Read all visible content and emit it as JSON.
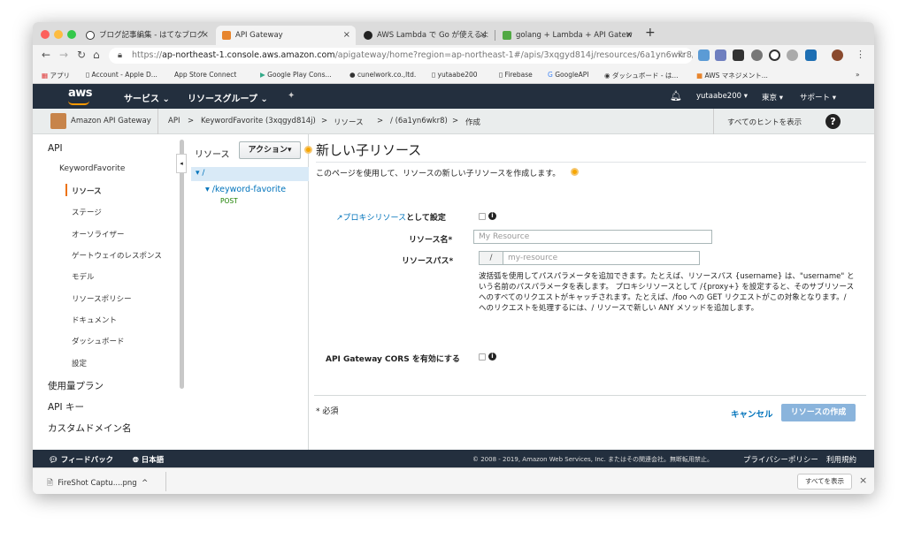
{
  "browser": {
    "tabs": [
      {
        "label": "ブログ記事編集 - はてなブログ",
        "active": false
      },
      {
        "label": "API Gateway",
        "active": true
      },
      {
        "label": "AWS Lambda で Go が使えるよ",
        "active": false
      },
      {
        "label": "golang + Lambda + API Gatew",
        "active": false
      }
    ],
    "url_secure": "https://",
    "url_host": "ap-northeast-1.console.aws.amazon.com",
    "url_path": "/apigateway/home?region=ap-northeast-1#/apis/3xqgyd814j/resources/6a1yn6wkr8/cr...",
    "bookmarks": [
      "アプリ",
      "Account - Apple D...",
      "App Store Connect",
      "Google Play Cons...",
      "cunelwork.co.,ltd.",
      "yutaabe200",
      "Firebase",
      "GoogleAPI",
      "ダッシュボード - は...",
      "AWS マネジメント..."
    ],
    "more": "»"
  },
  "aws_nav": {
    "logo": "aws",
    "services": "サービス ⌄",
    "resource_groups": "リソースグループ ⌄",
    "pin": "✦",
    "account": "yutaabe200 ▾",
    "region": "東京 ▾",
    "support": "サポート ▾"
  },
  "breadcrumb": {
    "service": "Amazon API Gateway",
    "api": "API",
    "sep": ">",
    "api_name": "KeywordFavorite (3xqgyd814j)",
    "resources": "リソース",
    "resource": "/ (6a1yn6wkr8)",
    "create": "作成",
    "hints": "すべてのヒントを表示",
    "help": "?"
  },
  "sidebar": {
    "api": "API",
    "api_name": "KeywordFavorite",
    "items": [
      "リソース",
      "ステージ",
      "オーソライザー",
      "ゲートウェイのレスポンス",
      "モデル",
      "リソースポリシー",
      "ドキュメント",
      "ダッシュボード",
      "設定"
    ],
    "bottom": [
      "使用量プラン",
      "API キー",
      "カスタムドメイン名"
    ],
    "collapse": "◂"
  },
  "resources": {
    "title": "リソース",
    "actions": "アクション▾",
    "root": "▾ /",
    "child": "▾ /keyword-favorite",
    "method": "POST"
  },
  "form": {
    "title": "新しい子リソース",
    "description": "このページを使用して、リソースの新しい子リソースを作成します。",
    "proxy_link": "プロキシリソース",
    "proxy_suffix": "として設定",
    "name_label": "リソース名*",
    "name_placeholder": "My Resource",
    "path_label": "リソースパス*",
    "path_prefix": "/",
    "path_placeholder": "my-resource",
    "help_text": "波括弧を使用してパスパラメータを追加できます。たとえば、リソースパス {username} は、\"username\" という名前のパスパラメータを表します。 プロキシリソースとして /{proxy+} を設定すると、そのサブリソースへのすべてのリクエストがキャッチされます。たとえば、/foo への GET リクエストがこの対象となります。/ へのリクエストを処理するには、/ リソースで新しい ANY メソッドを追加します。",
    "cors_label": "API Gateway CORS を有効にする",
    "required": "* 必須",
    "cancel": "キャンセル",
    "create": "リソースの作成",
    "info": "i"
  },
  "footer": {
    "feedback": "フィードバック",
    "language": "日本語",
    "copyright": "© 2008 - 2019, Amazon Web Services, Inc. またはその関連会社。無断転用禁止。",
    "privacy": "プライバシーポリシー",
    "terms": "利用規約"
  },
  "download": {
    "file": "FireShot Captu....png",
    "chevron": "^",
    "show_all": "すべてを表示",
    "close": "×"
  }
}
